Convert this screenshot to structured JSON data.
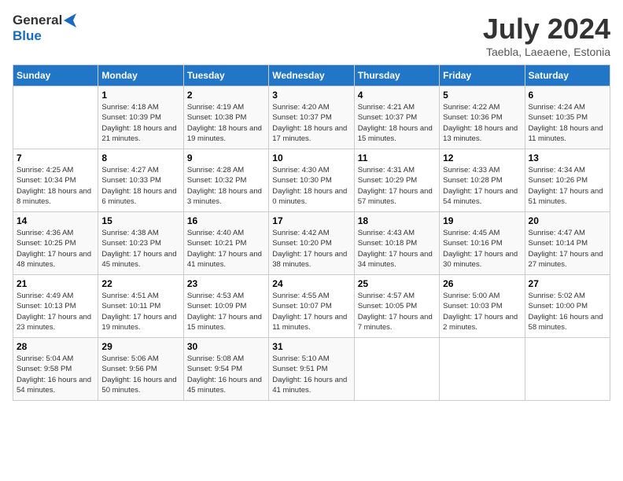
{
  "logo": {
    "line1": "General",
    "line2": "Blue"
  },
  "title": "July 2024",
  "location": "Taebla, Laeaene, Estonia",
  "days_of_week": [
    "Sunday",
    "Monday",
    "Tuesday",
    "Wednesday",
    "Thursday",
    "Friday",
    "Saturday"
  ],
  "weeks": [
    [
      {
        "day": "",
        "sunrise": "",
        "sunset": "",
        "daylight": ""
      },
      {
        "day": "1",
        "sunrise": "Sunrise: 4:18 AM",
        "sunset": "Sunset: 10:39 PM",
        "daylight": "Daylight: 18 hours and 21 minutes."
      },
      {
        "day": "2",
        "sunrise": "Sunrise: 4:19 AM",
        "sunset": "Sunset: 10:38 PM",
        "daylight": "Daylight: 18 hours and 19 minutes."
      },
      {
        "day": "3",
        "sunrise": "Sunrise: 4:20 AM",
        "sunset": "Sunset: 10:37 PM",
        "daylight": "Daylight: 18 hours and 17 minutes."
      },
      {
        "day": "4",
        "sunrise": "Sunrise: 4:21 AM",
        "sunset": "Sunset: 10:37 PM",
        "daylight": "Daylight: 18 hours and 15 minutes."
      },
      {
        "day": "5",
        "sunrise": "Sunrise: 4:22 AM",
        "sunset": "Sunset: 10:36 PM",
        "daylight": "Daylight: 18 hours and 13 minutes."
      },
      {
        "day": "6",
        "sunrise": "Sunrise: 4:24 AM",
        "sunset": "Sunset: 10:35 PM",
        "daylight": "Daylight: 18 hours and 11 minutes."
      }
    ],
    [
      {
        "day": "7",
        "sunrise": "Sunrise: 4:25 AM",
        "sunset": "Sunset: 10:34 PM",
        "daylight": "Daylight: 18 hours and 8 minutes."
      },
      {
        "day": "8",
        "sunrise": "Sunrise: 4:27 AM",
        "sunset": "Sunset: 10:33 PM",
        "daylight": "Daylight: 18 hours and 6 minutes."
      },
      {
        "day": "9",
        "sunrise": "Sunrise: 4:28 AM",
        "sunset": "Sunset: 10:32 PM",
        "daylight": "Daylight: 18 hours and 3 minutes."
      },
      {
        "day": "10",
        "sunrise": "Sunrise: 4:30 AM",
        "sunset": "Sunset: 10:30 PM",
        "daylight": "Daylight: 18 hours and 0 minutes."
      },
      {
        "day": "11",
        "sunrise": "Sunrise: 4:31 AM",
        "sunset": "Sunset: 10:29 PM",
        "daylight": "Daylight: 17 hours and 57 minutes."
      },
      {
        "day": "12",
        "sunrise": "Sunrise: 4:33 AM",
        "sunset": "Sunset: 10:28 PM",
        "daylight": "Daylight: 17 hours and 54 minutes."
      },
      {
        "day": "13",
        "sunrise": "Sunrise: 4:34 AM",
        "sunset": "Sunset: 10:26 PM",
        "daylight": "Daylight: 17 hours and 51 minutes."
      }
    ],
    [
      {
        "day": "14",
        "sunrise": "Sunrise: 4:36 AM",
        "sunset": "Sunset: 10:25 PM",
        "daylight": "Daylight: 17 hours and 48 minutes."
      },
      {
        "day": "15",
        "sunrise": "Sunrise: 4:38 AM",
        "sunset": "Sunset: 10:23 PM",
        "daylight": "Daylight: 17 hours and 45 minutes."
      },
      {
        "day": "16",
        "sunrise": "Sunrise: 4:40 AM",
        "sunset": "Sunset: 10:21 PM",
        "daylight": "Daylight: 17 hours and 41 minutes."
      },
      {
        "day": "17",
        "sunrise": "Sunrise: 4:42 AM",
        "sunset": "Sunset: 10:20 PM",
        "daylight": "Daylight: 17 hours and 38 minutes."
      },
      {
        "day": "18",
        "sunrise": "Sunrise: 4:43 AM",
        "sunset": "Sunset: 10:18 PM",
        "daylight": "Daylight: 17 hours and 34 minutes."
      },
      {
        "day": "19",
        "sunrise": "Sunrise: 4:45 AM",
        "sunset": "Sunset: 10:16 PM",
        "daylight": "Daylight: 17 hours and 30 minutes."
      },
      {
        "day": "20",
        "sunrise": "Sunrise: 4:47 AM",
        "sunset": "Sunset: 10:14 PM",
        "daylight": "Daylight: 17 hours and 27 minutes."
      }
    ],
    [
      {
        "day": "21",
        "sunrise": "Sunrise: 4:49 AM",
        "sunset": "Sunset: 10:13 PM",
        "daylight": "Daylight: 17 hours and 23 minutes."
      },
      {
        "day": "22",
        "sunrise": "Sunrise: 4:51 AM",
        "sunset": "Sunset: 10:11 PM",
        "daylight": "Daylight: 17 hours and 19 minutes."
      },
      {
        "day": "23",
        "sunrise": "Sunrise: 4:53 AM",
        "sunset": "Sunset: 10:09 PM",
        "daylight": "Daylight: 17 hours and 15 minutes."
      },
      {
        "day": "24",
        "sunrise": "Sunrise: 4:55 AM",
        "sunset": "Sunset: 10:07 PM",
        "daylight": "Daylight: 17 hours and 11 minutes."
      },
      {
        "day": "25",
        "sunrise": "Sunrise: 4:57 AM",
        "sunset": "Sunset: 10:05 PM",
        "daylight": "Daylight: 17 hours and 7 minutes."
      },
      {
        "day": "26",
        "sunrise": "Sunrise: 5:00 AM",
        "sunset": "Sunset: 10:03 PM",
        "daylight": "Daylight: 17 hours and 2 minutes."
      },
      {
        "day": "27",
        "sunrise": "Sunrise: 5:02 AM",
        "sunset": "Sunset: 10:00 PM",
        "daylight": "Daylight: 16 hours and 58 minutes."
      }
    ],
    [
      {
        "day": "28",
        "sunrise": "Sunrise: 5:04 AM",
        "sunset": "Sunset: 9:58 PM",
        "daylight": "Daylight: 16 hours and 54 minutes."
      },
      {
        "day": "29",
        "sunrise": "Sunrise: 5:06 AM",
        "sunset": "Sunset: 9:56 PM",
        "daylight": "Daylight: 16 hours and 50 minutes."
      },
      {
        "day": "30",
        "sunrise": "Sunrise: 5:08 AM",
        "sunset": "Sunset: 9:54 PM",
        "daylight": "Daylight: 16 hours and 45 minutes."
      },
      {
        "day": "31",
        "sunrise": "Sunrise: 5:10 AM",
        "sunset": "Sunset: 9:51 PM",
        "daylight": "Daylight: 16 hours and 41 minutes."
      },
      {
        "day": "",
        "sunrise": "",
        "sunset": "",
        "daylight": ""
      },
      {
        "day": "",
        "sunrise": "",
        "sunset": "",
        "daylight": ""
      },
      {
        "day": "",
        "sunrise": "",
        "sunset": "",
        "daylight": ""
      }
    ]
  ]
}
